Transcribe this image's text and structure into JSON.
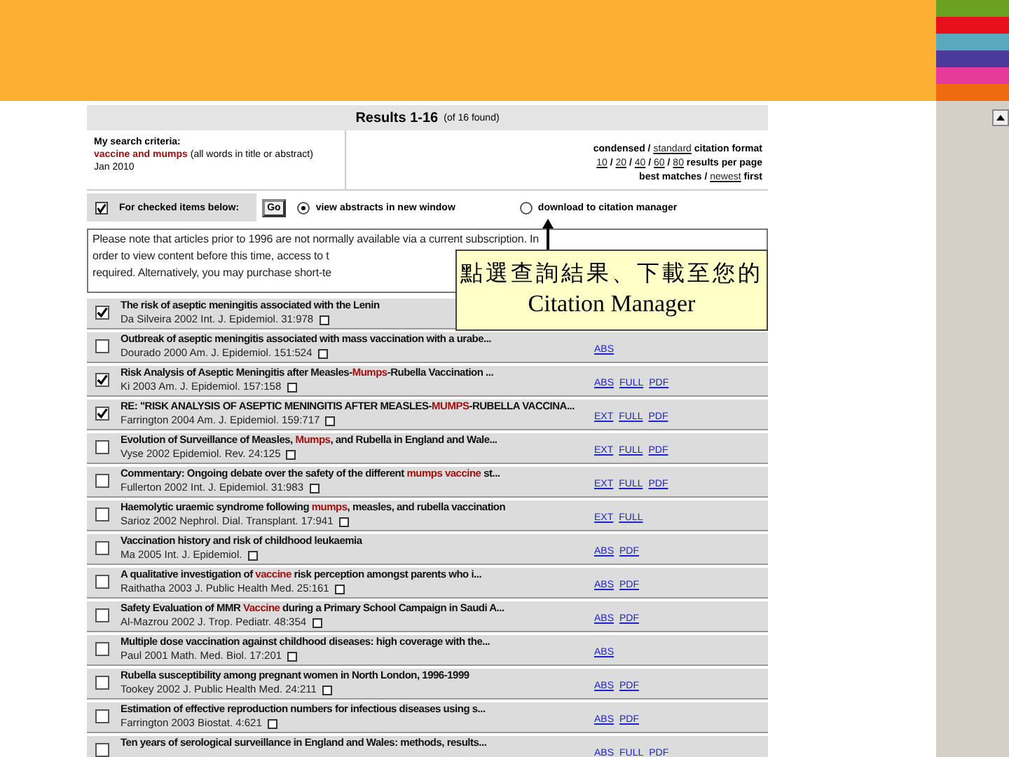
{
  "stripes": [
    {
      "color": "#6aa121"
    },
    {
      "color": "#e8101a"
    },
    {
      "color": "#5aa8c0"
    },
    {
      "color": "#4c3a9a"
    },
    {
      "color": "#e83a9a"
    },
    {
      "color": "#f06a10"
    }
  ],
  "results_header": {
    "title": "Results 1-16",
    "count": "(of 16 found)"
  },
  "criteria": {
    "label": "My search criteria:",
    "query": "vaccine and mumps",
    "scope": "(all words in title or abstract)",
    "date": "Jan 2010"
  },
  "options": [
    {
      "parts": [
        {
          "text": "condensed",
          "link": false
        },
        {
          "text": " / ",
          "link": false
        },
        {
          "text": "standard",
          "link": true
        },
        {
          "text": " citation format",
          "link": false
        }
      ]
    },
    {
      "parts": [
        {
          "text": "10",
          "link": true
        },
        {
          "text": " / ",
          "link": false
        },
        {
          "text": "20",
          "link": true
        },
        {
          "text": " / ",
          "link": false
        },
        {
          "text": "40",
          "link": true
        },
        {
          "text": " / ",
          "link": false
        },
        {
          "text": "60",
          "link": true
        },
        {
          "text": " / ",
          "link": false
        },
        {
          "text": "80",
          "link": true
        },
        {
          "text": " results per page",
          "link": false
        }
      ]
    },
    {
      "parts": [
        {
          "text": "best matches",
          "link": false
        },
        {
          "text": " / ",
          "link": false
        },
        {
          "text": "newest",
          "link": true
        },
        {
          "text": " first",
          "link": false
        }
      ]
    }
  ],
  "toolbar": {
    "label": "For checked items below:",
    "button": "Go",
    "radios": [
      {
        "label": "view abstracts in new window",
        "selected": true
      },
      {
        "label": "download to citation manager",
        "selected": false
      }
    ]
  },
  "notice": [
    "Please note that articles prior to 1996 are not normally available via a current subscription. In",
    "order to view content before this time, access to t",
    "required. Alternatively, you may purchase short-te"
  ],
  "callout": [
    "點選查詢結果、下載至您的",
    "Citation Manager"
  ],
  "results": [
    {
      "checked": true,
      "title": [
        {
          "text": "The risk of aseptic meningitis associated with the Lenin",
          "hit": false
        }
      ],
      "citation": "Da Silveira 2002 Int. J. Epidemiol. 31:978"
    },
    {
      "checked": false,
      "title": [
        {
          "text": "Outbreak of aseptic meningitis associated with mass vaccination with a urabe...",
          "hit": false
        }
      ],
      "citation": "Dourado 2000 Am. J. Epidemiol. 151:524",
      "links": [
        "ABS"
      ]
    },
    {
      "checked": true,
      "title": [
        {
          "text": "Risk Analysis of Aseptic Meningitis after Measles-",
          "hit": false
        },
        {
          "text": "Mumps",
          "hit": true
        },
        {
          "text": "-Rubella Vaccination ...",
          "hit": false
        }
      ],
      "citation": "Ki 2003 Am. J. Epidemiol. 157:158",
      "links": [
        "ABS",
        "FULL",
        "PDF"
      ]
    },
    {
      "checked": true,
      "title": [
        {
          "text": "RE: \"RISK ANALYSIS OF ASEPTIC MENINGITIS AFTER MEASLES-",
          "hit": false
        },
        {
          "text": "MUMPS",
          "hit": true
        },
        {
          "text": "-RUBELLA VACCINA...",
          "hit": false
        }
      ],
      "citation": "Farrington 2004 Am. J. Epidemiol. 159:717",
      "links": [
        "EXT",
        "FULL",
        "PDF"
      ]
    },
    {
      "checked": false,
      "title": [
        {
          "text": "Evolution of Surveillance of Measles, ",
          "hit": false
        },
        {
          "text": "Mumps",
          "hit": true
        },
        {
          "text": ", and Rubella in England and Wale...",
          "hit": false
        }
      ],
      "citation": "Vyse 2002 Epidemiol. Rev. 24:125",
      "links": [
        "EXT",
        "FULL",
        "PDF"
      ]
    },
    {
      "checked": false,
      "title": [
        {
          "text": "Commentary: Ongoing debate over the safety of the different ",
          "hit": false
        },
        {
          "text": "mumps vaccine",
          "hit": true
        },
        {
          "text": " st...",
          "hit": false
        }
      ],
      "citation": "Fullerton 2002 Int. J. Epidemiol. 31:983",
      "links": [
        "EXT",
        "FULL",
        "PDF"
      ]
    },
    {
      "checked": false,
      "title": [
        {
          "text": "Haemolytic uraemic syndrome following ",
          "hit": false
        },
        {
          "text": "mumps",
          "hit": true
        },
        {
          "text": ", measles, and rubella vaccination",
          "hit": false
        }
      ],
      "citation": "Sarioz 2002 Nephrol. Dial. Transplant. 17:941",
      "links": [
        "EXT",
        "FULL"
      ]
    },
    {
      "checked": false,
      "title": [
        {
          "text": "Vaccination history and risk of childhood leukaemia",
          "hit": false
        }
      ],
      "citation": "Ma 2005 Int. J. Epidemiol.",
      "links": [
        "ABS",
        "PDF"
      ]
    },
    {
      "checked": false,
      "title": [
        {
          "text": "A qualitative investigation of ",
          "hit": false
        },
        {
          "text": "vaccine",
          "hit": true
        },
        {
          "text": " risk perception amongst parents who i...",
          "hit": false
        }
      ],
      "citation": "Raithatha 2003 J. Public Health Med. 25:161",
      "links": [
        "ABS",
        "PDF"
      ]
    },
    {
      "checked": false,
      "title": [
        {
          "text": "Safety Evaluation of MMR ",
          "hit": false
        },
        {
          "text": "Vaccine",
          "hit": true
        },
        {
          "text": " during a Primary School Campaign in Saudi A...",
          "hit": false
        }
      ],
      "citation": "Al-Mazrou 2002 J. Trop. Pediatr. 48:354",
      "links": [
        "ABS",
        "PDF"
      ]
    },
    {
      "checked": false,
      "title": [
        {
          "text": "Multiple dose vaccination against childhood diseases: high coverage with the...",
          "hit": false
        }
      ],
      "citation": "Paul 2001 Math. Med. Biol. 17:201",
      "links": [
        "ABS"
      ]
    },
    {
      "checked": false,
      "title": [
        {
          "text": "Rubella susceptibility among pregnant women in North London, 1996-1999",
          "hit": false
        }
      ],
      "citation": "Tookey 2002 J. Public Health Med. 24:211",
      "links": [
        "ABS",
        "PDF"
      ]
    },
    {
      "checked": false,
      "title": [
        {
          "text": "Estimation of effective reproduction numbers for infectious diseases using s...",
          "hit": false
        }
      ],
      "citation": "Farrington 2003 Biostat. 4:621",
      "links": [
        "ABS",
        "PDF"
      ]
    },
    {
      "checked": false,
      "title": [
        {
          "text": "Ten years of serological surveillance in England and Wales: methods, results...",
          "hit": false
        }
      ],
      "links": [
        "ABS",
        "FULL",
        "PDF"
      ]
    }
  ]
}
